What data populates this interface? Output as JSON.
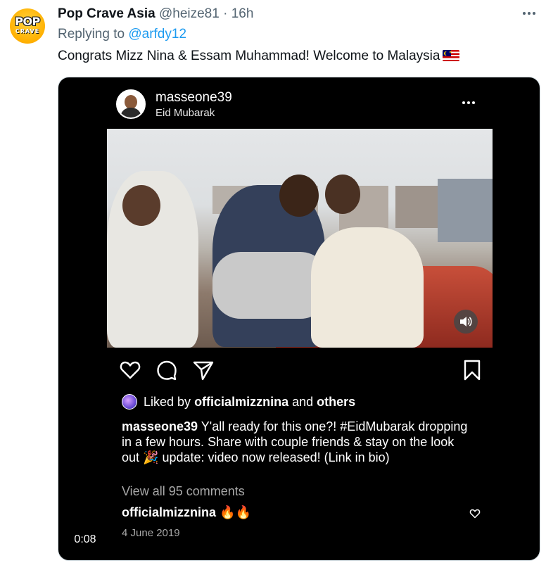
{
  "tweet": {
    "author_name": "Pop Crave Asia",
    "handle": "@heize81",
    "separator": "·",
    "time": "16h",
    "avatar_text_top": "POP",
    "avatar_text_bottom": "CRAVE",
    "replying_prefix": "Replying to",
    "replying_to": "@arfdy12",
    "text": "Congrats Mizz Nina & Essam Muhammad! Welcome to Malaysia",
    "flag_icon": "malaysia-flag-icon",
    "more_icon": "more-horizontal-icon"
  },
  "media": {
    "duration": "0:08",
    "instagram_post": {
      "username": "masseone39",
      "subtitle": "Eid Mubarak",
      "liked_by_prefix": "Liked by",
      "liked_by_user": "officialmizznina",
      "liked_by_and": "and",
      "liked_by_others": "others",
      "caption_user": "masseone39",
      "caption_text_1": " Y'all ready for this one?! #EidMubarak dropping in a few hours. Share with couple friends & stay on the look out ",
      "caption_emoji": "🎉",
      "caption_text_2": " update: video now released! (Link in bio)",
      "view_comments": "View all 95 comments",
      "comment_user": "officialmizznina",
      "comment_emoji": "🔥🔥",
      "date": "4 June 2019",
      "icons": [
        "heart-icon",
        "comment-icon",
        "share-icon",
        "bookmark-icon",
        "sound-icon"
      ]
    }
  }
}
